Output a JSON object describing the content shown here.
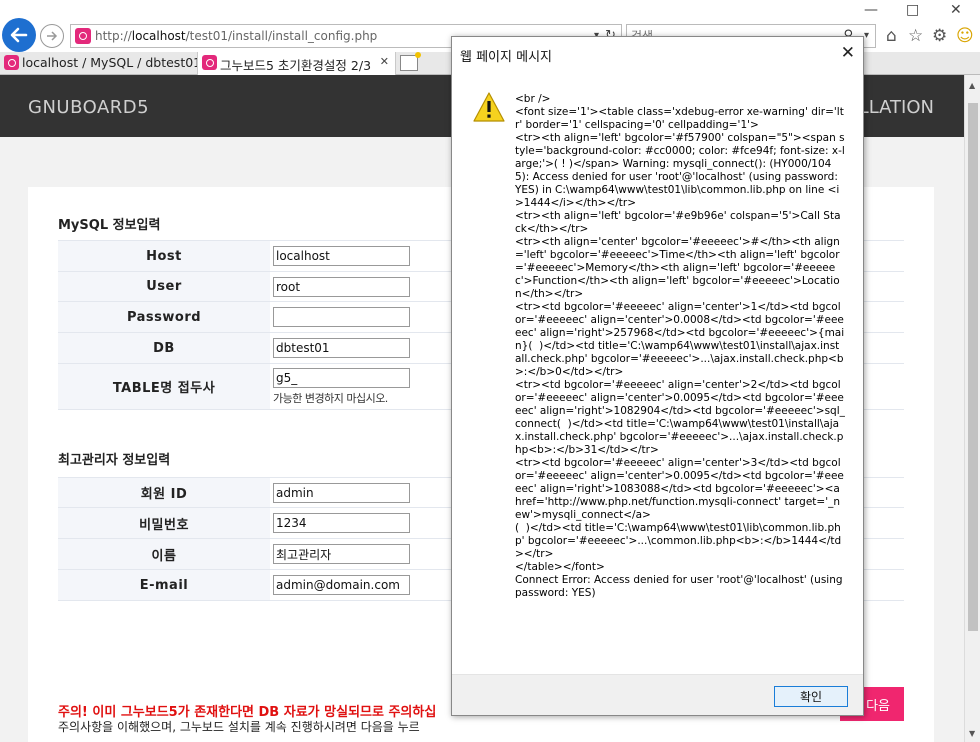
{
  "browser": {
    "address": {
      "prefix": "http://",
      "host": "localhost",
      "path": "/test01/install/install_config.php"
    },
    "search_placeholder": "검색",
    "tabs": [
      {
        "label": "localhost / MySQL / dbtest01..."
      },
      {
        "label": "그누보드5 초기환경설정 2/3"
      }
    ]
  },
  "header": {
    "logo": "GNUBOARD5",
    "right_text": "LLATION"
  },
  "mysql": {
    "title": "MySQL 정보입력",
    "rows": [
      {
        "label": "Host",
        "value": "localhost"
      },
      {
        "label": "User",
        "value": "root"
      },
      {
        "label": "Password",
        "value": ""
      },
      {
        "label": "DB",
        "value": "dbtest01"
      },
      {
        "label": "TABLE명 접두사",
        "value": "g5_"
      }
    ],
    "prefix_hint": "가능한 변경하지 마십시오."
  },
  "admin": {
    "title": "최고관리자 정보입력",
    "rows": [
      {
        "label": "회원 ID",
        "value": "admin"
      },
      {
        "label": "비밀번호",
        "value": "1234"
      },
      {
        "label": "이름",
        "value": "최고관리자"
      },
      {
        "label": "E-mail",
        "value": "admin@domain.com"
      }
    ]
  },
  "warning": "주의! 이미 그누보드5가 존재한다면 DB 자료가 망실되므로 주의하십",
  "notice": "주의사항을 이해했으며, 그누보드 설치를 계속 진행하시려면 다음을 누르",
  "next_label": "다음",
  "dialog": {
    "title": "웹 페이지 메시지",
    "message": "<br />\n<font size='1'><table class='xdebug-error xe-warning' dir='ltr' border='1' cellspacing='0' cellpadding='1'>\n<tr><th align='left' bgcolor='#f57900' colspan=\"5\"><span style='background-color: #cc0000; color: #fce94f; font-size: x-large;'>( ! )</span> Warning: mysqli_connect(): (HY000/1045): Access denied for user 'root'@'localhost' (using password: YES) in C:\\wamp64\\www\\test01\\lib\\common.lib.php on line <i>1444</i></th></tr>\n<tr><th align='left' bgcolor='#e9b96e' colspan='5'>Call Stack</th></tr>\n<tr><th align='center' bgcolor='#eeeeec'>#</th><th align='left' bgcolor='#eeeeec'>Time</th><th align='left' bgcolor='#eeeeec'>Memory</th><th align='left' bgcolor='#eeeeec'>Function</th><th align='left' bgcolor='#eeeeec'>Location</th></tr>\n<tr><td bgcolor='#eeeeec' align='center'>1</td><td bgcolor='#eeeeec' align='center'>0.0008</td><td bgcolor='#eeeeec' align='right'>257968</td><td bgcolor='#eeeeec'>{main}(  )</td><td title='C:\\wamp64\\www\\test01\\install\\ajax.install.check.php' bgcolor='#eeeeec'>...\\ajax.install.check.php<b>:</b>0</td></tr>\n<tr><td bgcolor='#eeeeec' align='center'>2</td><td bgcolor='#eeeeec' align='center'>0.0095</td><td bgcolor='#eeeeec' align='right'>1082904</td><td bgcolor='#eeeeec'>sql_connect(  )</td><td title='C:\\wamp64\\www\\test01\\install\\ajax.install.check.php' bgcolor='#eeeeec'>...\\ajax.install.check.php<b>:</b>31</td></tr>\n<tr><td bgcolor='#eeeeec' align='center'>3</td><td bgcolor='#eeeeec' align='center'>0.0095</td><td bgcolor='#eeeeec' align='right'>1083088</td><td bgcolor='#eeeeec'><a href='http://www.php.net/function.mysqli-connect' target='_new'>mysqli_connect</a>\n(  )</td><td title='C:\\wamp64\\www\\test01\\lib\\common.lib.php' bgcolor='#eeeeec'>...\\common.lib.php<b>:</b>1444</td></tr>\n</table></font>\nConnect Error: Access denied for user 'root'@'localhost' (using password: YES)",
    "ok_label": "확인"
  }
}
